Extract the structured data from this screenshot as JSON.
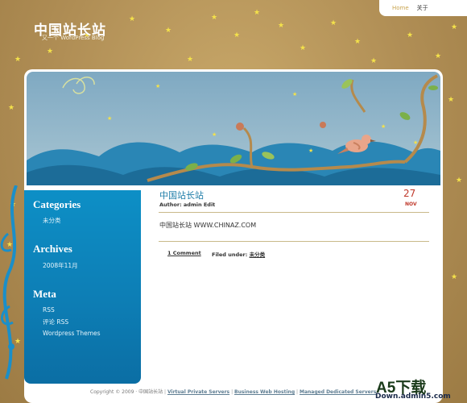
{
  "site": {
    "title": "中国站长站",
    "description": "又一个 WordPress Blog"
  },
  "nav": {
    "home": "Home",
    "about": "关于"
  },
  "sidebar": {
    "categories_title": "Categories",
    "categories": [
      "未分类"
    ],
    "archives_title": "Archives",
    "archives": [
      "2008年11月"
    ],
    "meta_title": "Meta",
    "meta": [
      "RSS",
      "评论 RSS",
      "Wordpress Themes"
    ]
  },
  "post": {
    "title": "中国站长站",
    "meta": "Author: admin Edit",
    "day": "27",
    "month": "NOV",
    "content": "中国站长站  WWW.CHINAZ.COM",
    "comments": "1 Comment",
    "filed_label": "Filed under:",
    "filed_category": "未分类"
  },
  "footer": {
    "copyright": "Copyright © 2009 · 中国站长站",
    "links": [
      "Virtual Private Servers",
      "Web Hosting",
      "Managed Dedicated Servers"
    ],
    "link_prefixes": [
      "",
      "Business ",
      ""
    ]
  },
  "watermark": {
    "main": "A5下载",
    "url": "Down.admin5.com"
  },
  "colors": {
    "background": "#b08e55",
    "sidebar": "#0d7db4",
    "post_title": "#1e7da8",
    "date": "#c0392b",
    "star": "#f4e24a"
  }
}
